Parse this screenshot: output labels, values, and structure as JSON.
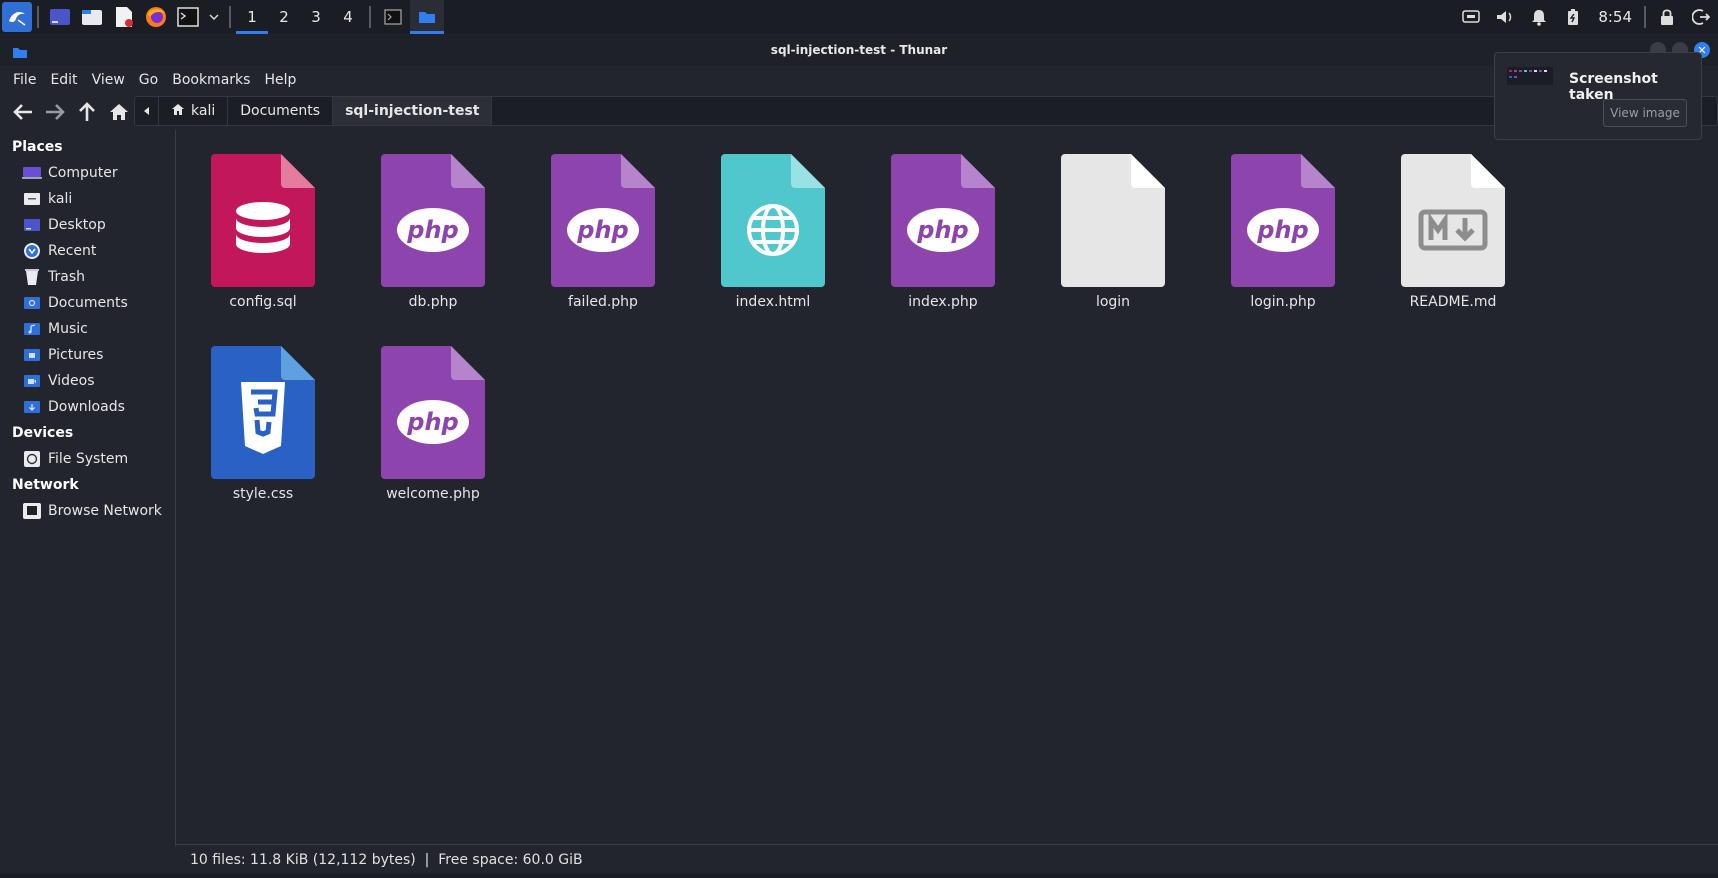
{
  "panel": {
    "workspaces": [
      "1",
      "2",
      "3",
      "4"
    ],
    "active_workspace": "1",
    "clock": "8:54"
  },
  "window": {
    "title": "sql-injection-test - Thunar"
  },
  "menubar": {
    "items": [
      "File",
      "Edit",
      "View",
      "Go",
      "Bookmarks",
      "Help"
    ]
  },
  "pathbar": {
    "crumbs": [
      "kali",
      "Documents",
      "sql-injection-test"
    ]
  },
  "sidebar": {
    "places_label": "Places",
    "places": [
      {
        "label": "Computer",
        "icon": "computer-icon"
      },
      {
        "label": "kali",
        "icon": "home-folder-icon"
      },
      {
        "label": "Desktop",
        "icon": "desktop-folder-icon"
      },
      {
        "label": "Recent",
        "icon": "recent-icon"
      },
      {
        "label": "Trash",
        "icon": "trash-icon"
      },
      {
        "label": "Documents",
        "icon": "documents-folder-icon"
      },
      {
        "label": "Music",
        "icon": "music-folder-icon"
      },
      {
        "label": "Pictures",
        "icon": "pictures-folder-icon"
      },
      {
        "label": "Videos",
        "icon": "videos-folder-icon"
      },
      {
        "label": "Downloads",
        "icon": "downloads-folder-icon"
      }
    ],
    "devices_label": "Devices",
    "devices": [
      {
        "label": "File System",
        "icon": "drive-icon"
      }
    ],
    "network_label": "Network",
    "network": [
      {
        "label": "Browse Network",
        "icon": "network-icon"
      }
    ]
  },
  "files": [
    {
      "name": "config.sql",
      "type": "sql",
      "color": "#c2185b"
    },
    {
      "name": "db.php",
      "type": "php",
      "color": "#8e44ad"
    },
    {
      "name": "failed.php",
      "type": "php",
      "color": "#8e44ad"
    },
    {
      "name": "index.html",
      "type": "html",
      "color": "#4fc7cc"
    },
    {
      "name": "index.php",
      "type": "php",
      "color": "#8e44ad"
    },
    {
      "name": "login",
      "type": "blank",
      "color": "#e6e6e6"
    },
    {
      "name": "login.php",
      "type": "php",
      "color": "#8e44ad"
    },
    {
      "name": "README.md",
      "type": "markdown",
      "color": "#e6e6e6"
    },
    {
      "name": "style.css",
      "type": "css",
      "color": "#2962c4"
    },
    {
      "name": "welcome.php",
      "type": "php",
      "color": "#8e44ad"
    }
  ],
  "status": {
    "text": "10 files: 11.8 KiB (12,112 bytes)  |  Free space: 60.0 GiB"
  },
  "notification": {
    "title": "Screenshot taken",
    "button": "View image"
  },
  "colors": {
    "accent": "#2f7ff0",
    "background": "#23252e"
  }
}
